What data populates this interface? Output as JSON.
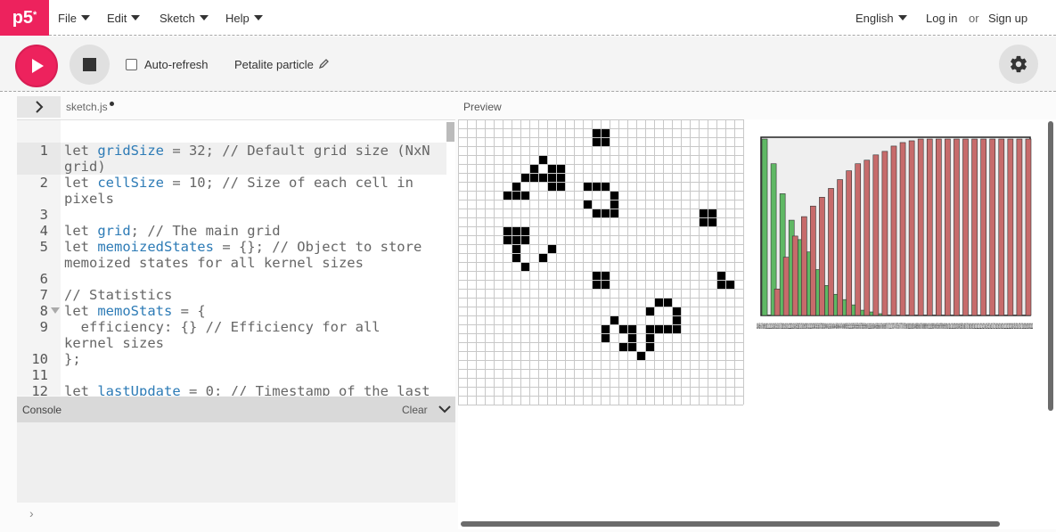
{
  "app": {
    "logo": "p5",
    "logo_sup": "*",
    "menus": [
      {
        "label": "File"
      },
      {
        "label": "Edit"
      },
      {
        "label": "Sketch"
      },
      {
        "label": "Help"
      }
    ],
    "language": "English",
    "login": "Log in",
    "or": "or",
    "signup": "Sign up"
  },
  "toolbar": {
    "auto_refresh_label": "Auto-refresh",
    "auto_refresh_checked": false,
    "project_name": "Petalite particle"
  },
  "editor": {
    "tab_name": "sketch.js",
    "lines": [
      {
        "n": "1",
        "text": "let gridSize = 32; // Default grid size (NxN grid)",
        "active": true
      },
      {
        "n": "2",
        "text": "let cellSize = 10; // Size of each cell in pixels"
      },
      {
        "n": "3",
        "text": ""
      },
      {
        "n": "4",
        "text": "let grid; // The main grid"
      },
      {
        "n": "5",
        "text": "let memoizedStates = {}; // Object to store memoized states for all kernel sizes"
      },
      {
        "n": "6",
        "text": ""
      },
      {
        "n": "7",
        "text": "// Statistics"
      },
      {
        "n": "8",
        "text": "let memoStats = {",
        "fold": true
      },
      {
        "n": "9",
        "text": "  efficiency: {} // Efficiency for all kernel sizes"
      },
      {
        "n": "10",
        "text": "};"
      },
      {
        "n": "11",
        "text": ""
      },
      {
        "n": "12",
        "text": "let lastUpdate = 0; // Timestamp of the last"
      }
    ]
  },
  "console": {
    "title": "Console",
    "clear_label": "Clear",
    "prompt": "›"
  },
  "preview": {
    "label": "Preview",
    "grid": {
      "size": 32,
      "live_cells": [
        [
          15,
          1
        ],
        [
          16,
          1
        ],
        [
          15,
          2
        ],
        [
          16,
          2
        ],
        [
          9,
          4
        ],
        [
          8,
          5
        ],
        [
          10,
          5
        ],
        [
          11,
          5
        ],
        [
          7,
          6
        ],
        [
          8,
          6
        ],
        [
          9,
          6
        ],
        [
          10,
          6
        ],
        [
          11,
          6
        ],
        [
          6,
          7
        ],
        [
          10,
          7
        ],
        [
          11,
          7
        ],
        [
          14,
          7
        ],
        [
          15,
          7
        ],
        [
          16,
          7
        ],
        [
          5,
          8
        ],
        [
          6,
          8
        ],
        [
          7,
          8
        ],
        [
          17,
          8
        ],
        [
          14,
          9
        ],
        [
          17,
          9
        ],
        [
          15,
          10
        ],
        [
          16,
          10
        ],
        [
          17,
          10
        ],
        [
          27,
          10
        ],
        [
          28,
          10
        ],
        [
          27,
          11
        ],
        [
          28,
          11
        ],
        [
          5,
          12
        ],
        [
          6,
          12
        ],
        [
          7,
          12
        ],
        [
          5,
          13
        ],
        [
          6,
          13
        ],
        [
          7,
          13
        ],
        [
          6,
          14
        ],
        [
          10,
          14
        ],
        [
          6,
          15
        ],
        [
          9,
          15
        ],
        [
          7,
          16
        ],
        [
          15,
          17
        ],
        [
          16,
          17
        ],
        [
          29,
          17
        ],
        [
          15,
          18
        ],
        [
          16,
          18
        ],
        [
          29,
          18
        ],
        [
          30,
          18
        ],
        [
          22,
          20
        ],
        [
          23,
          20
        ],
        [
          21,
          21
        ],
        [
          24,
          21
        ],
        [
          17,
          22
        ],
        [
          24,
          22
        ],
        [
          16,
          23
        ],
        [
          18,
          23
        ],
        [
          19,
          23
        ],
        [
          21,
          23
        ],
        [
          22,
          23
        ],
        [
          23,
          23
        ],
        [
          24,
          23
        ],
        [
          16,
          24
        ],
        [
          19,
          24
        ],
        [
          21,
          24
        ],
        [
          18,
          25
        ],
        [
          19,
          25
        ],
        [
          21,
          25
        ],
        [
          20,
          26
        ]
      ]
    },
    "chart": {
      "colors": {
        "green": "#5fb864",
        "red": "#c76b6b",
        "frame_bg": "#efefef"
      },
      "tick_labels": "3x3 4x4 5x5 6x6 7x7 8x8 9x9 10x10 11x11 12x12 13x13 14x14 15x15 16x16 17x17 18x18 19x19 20x20 21x21 22x22 23x23 24x24 25x25 26x26 27x27 28x28 29x29 30x30 31x31 32x32 33x33 34x34 35x35 36x36 37x37 38x38 39x39 40x40 41x41 42x42 43x43 44x44 45x45 46x46 47x47 48x48 49x49 50x50 51x51 52x52 53x53 54x54 55x55 56x56 57x57 58x58 59x59 60x60 61x61 62x62 63x63 64x64 65x65 66x66 67x67 68x68 69x69 70x70 71x71 72x72 73x73 74x74 75x75 76x76 77x77 78x78 79x79 80x80 81x81 82x82 83x83 84x84 85x85 86x86 87x87 88x88 89x89 90x90 91x91 92x92 93x93 94x94 95x95 96x96 97x97 98x98 99x99 100x100 101x101 102x102 103x103 104x104 105x105 106x106 107x107 108x108 109x109 110x110 111x111 112x112 113x113 114x114 115x115 116x116 117x117 118x118 119x119 120x120 121x121 122x122 123x123 124x124 125x125 126x126 127x127 128x128 129x129 130x130 131x131",
      "green_values": [
        1.0,
        0.86,
        0.69,
        0.54,
        0.43,
        0.36,
        0.26,
        0.17,
        0.12,
        0.09,
        0.06,
        0.03,
        0.02,
        0.01,
        0,
        0,
        0,
        0,
        0,
        0,
        0,
        0,
        0,
        0,
        0,
        0,
        0,
        0,
        0,
        0
      ],
      "red_values": [
        0.0,
        0.15,
        0.33,
        0.45,
        0.56,
        0.62,
        0.67,
        0.72,
        0.77,
        0.82,
        0.86,
        0.88,
        0.91,
        0.93,
        0.96,
        0.98,
        0.99,
        1.0,
        1.0,
        1.0,
        1.0,
        1.0,
        1.0,
        1.0,
        1.0,
        1.0,
        1.0,
        1.0,
        1.0,
        1.0
      ]
    }
  }
}
